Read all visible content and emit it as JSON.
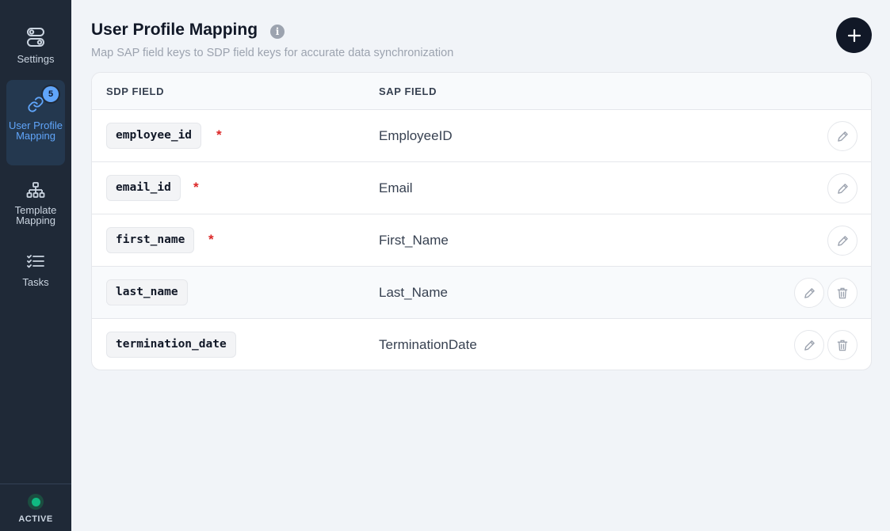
{
  "sidebar": {
    "items": [
      {
        "label": "Settings",
        "icon": "toggle-icon"
      },
      {
        "label": "User Profile Mapping",
        "icon": "link-icon",
        "badge": "5",
        "active": true
      },
      {
        "label": "Template Mapping",
        "icon": "hierarchy-icon"
      },
      {
        "label": "Tasks",
        "icon": "checklist-icon"
      }
    ],
    "status": "ACTIVE"
  },
  "header": {
    "title": "User Profile Mapping",
    "info_glyph": "i",
    "subtitle": "Map SAP field keys to SDP field keys for accurate data synchronization",
    "add_glyph": "+"
  },
  "table": {
    "columns": [
      "SDP FIELD",
      "SAP FIELD"
    ],
    "required_mark": "*",
    "rows": [
      {
        "sdp": "employee_id",
        "sap": "EmployeeID",
        "required": true
      },
      {
        "sdp": "email_id",
        "sap": "Email",
        "required": true
      },
      {
        "sdp": "first_name",
        "sap": "First_Name",
        "required": true
      },
      {
        "sdp": "last_name",
        "sap": "Last_Name",
        "required": false
      },
      {
        "sdp": "termination_date",
        "sap": "TerminationDate",
        "required": false
      }
    ]
  },
  "colors": {
    "sidebar_bg": "#1f2937",
    "accent": "#60a5fa",
    "status": "#10b981",
    "required": "#dc2626"
  }
}
